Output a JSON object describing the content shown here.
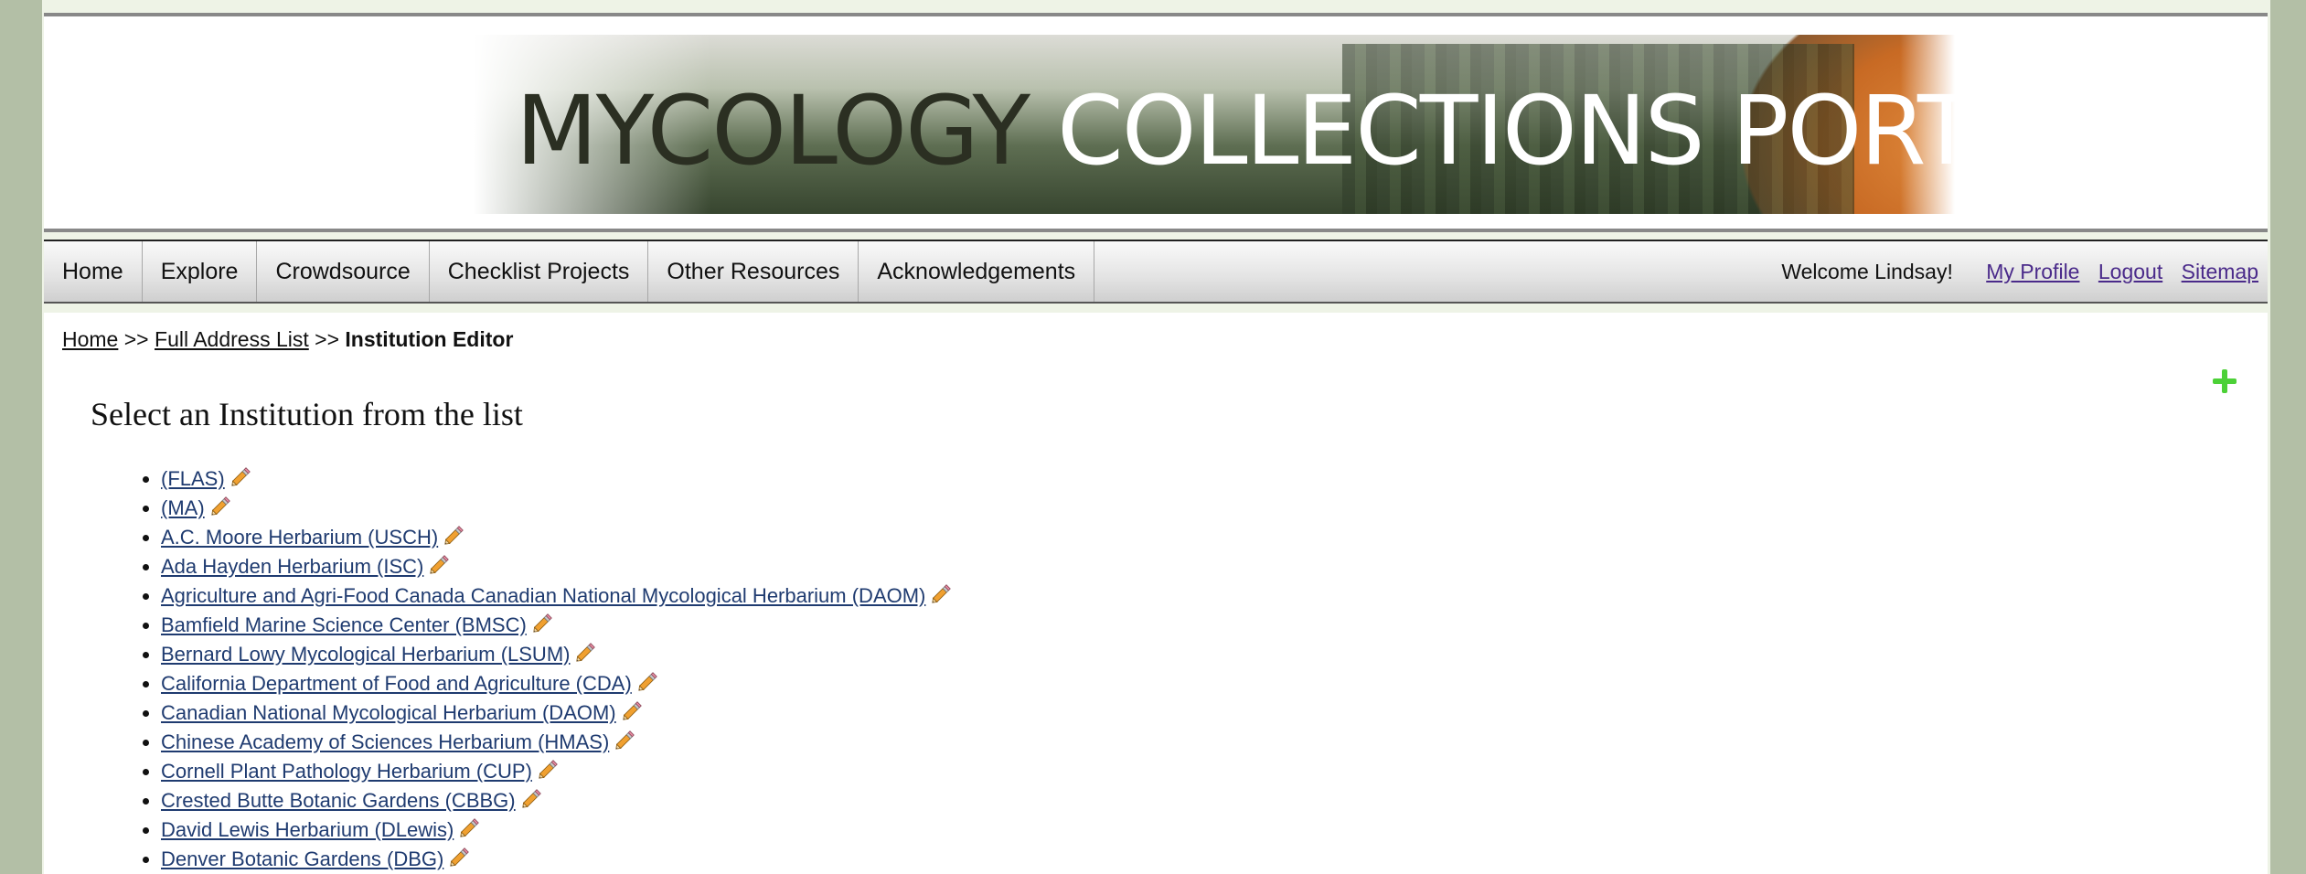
{
  "banner": {
    "title_dark": "MYCOLOGY",
    "title_light": "COLLECTIONS PORTAL"
  },
  "nav": {
    "items": [
      {
        "label": "Home"
      },
      {
        "label": "Explore"
      },
      {
        "label": "Crowdsource"
      },
      {
        "label": "Checklist Projects"
      },
      {
        "label": "Other Resources"
      },
      {
        "label": "Acknowledgements"
      }
    ],
    "welcome": "Welcome Lindsay!",
    "my_profile": "My Profile",
    "logout": "Logout",
    "sitemap": "Sitemap"
  },
  "breadcrumb": {
    "home": "Home",
    "sep1": ">>",
    "full_list": "Full Address List",
    "sep2": ">>",
    "current": "Institution Editor"
  },
  "page": {
    "heading": "Select an Institution from the list"
  },
  "institutions": [
    "(FLAS)",
    "(MA)",
    "A.C. Moore Herbarium (USCH)",
    "Ada Hayden Herbarium (ISC)",
    "Agriculture and Agri-Food Canada Canadian National Mycological Herbarium (DAOM)",
    "Bamfield Marine Science Center (BMSC)",
    "Bernard Lowy Mycological Herbarium (LSUM)",
    "California Department of Food and Agriculture (CDA)",
    "Canadian National Mycological Herbarium (DAOM)",
    "Chinese Academy of Sciences Herbarium (HMAS)",
    "Cornell Plant Pathology Herbarium (CUP)",
    "Crested Butte Botanic Gardens (CBBG)",
    "David Lewis Herbarium (DLewis)",
    "Denver Botanic Gardens (DBG)"
  ],
  "icons": {
    "edit": "pencil-icon",
    "add": "plus-icon"
  },
  "colors": {
    "link": "#1f3b70",
    "visited_link": "#4a2a8a",
    "add_icon": "#4cd137",
    "page_bg": "#b3bfa6"
  }
}
